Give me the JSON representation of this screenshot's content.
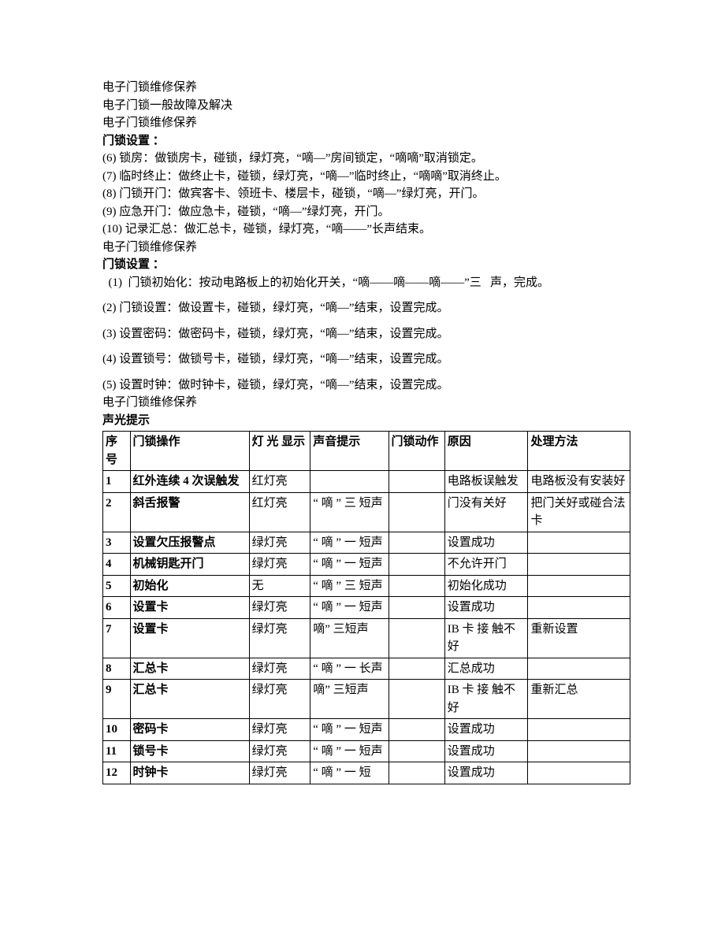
{
  "title1": "电子门锁维修保养",
  "title2": "电子门锁一般故障及解决",
  "title3": "电子门锁维修保养",
  "sec1_heading": "门锁设置 ：",
  "sec1_items": {
    "i6": "(6)  锁房：做锁房卡，碰锁，绿灯亮，“嘀—”房间锁定，“嘀嘀”取消锁定。",
    "i7": "(7)  临时终止：做终止卡，碰锁，绿灯亮，“嘀—”临时终止，“嘀嘀”取消终止。",
    "i8": "(8)  门锁开门：做宾客卡、领班卡、楼层卡，碰锁，“嘀—”绿灯亮，开门。",
    "i9": "(9)  应急开门：做应急卡，碰锁，“嘀—”绿灯亮，开门。",
    "i10": "(10) 记录汇总：做汇总卡，碰锁，绿灯亮，“嘀——”长声结束。"
  },
  "title4": "电子门锁维修保养",
  "sec2_heading": "门锁设置 ：",
  "sec2_items": {
    "i1": "  (1)  门锁初始化：按动电路板上的初始化开关，“嘀——嘀——嘀——”三   声，完成。",
    "i2": "(2)  门锁设置：做设置卡，碰锁，绿灯亮，“嘀—”结束，设置完成。",
    "i3": "(3)  设置密码：做密码卡，碰锁，绿灯亮，“嘀—”结束，设置完成。",
    "i4": "(4)  设置锁号：做锁号卡，碰锁，绿灯亮，“嘀—”结束，设置完成。",
    "i5": "(5)  设置时钟：做时钟卡，碰锁，绿灯亮，“嘀—”结束，设置完成。"
  },
  "title5": "电子门锁维修保养",
  "table_heading": "声光提示",
  "table": {
    "headers": {
      "seq": "序号",
      "op": "门锁操作",
      "led": "灯 光 显示",
      "snd": "声音提示",
      "act": "门锁动作",
      "rsn": "原因",
      "fix": "处理方法"
    },
    "rows": [
      {
        "seq": "1",
        "op": "红外连续 4 次误触发",
        "led": "红灯亮",
        "snd": "",
        "act": "",
        "rsn": "电路板误触发",
        "fix": "电路板没有安装好"
      },
      {
        "seq": "2",
        "op": "斜舌报警",
        "led": "红灯亮",
        "snd": "“ 嘀 ” 三 短声",
        "act": "",
        "rsn": "门没有关好",
        "fix": "把门关好或碰合法卡"
      },
      {
        "seq": "3",
        "op": "设置欠压报警点",
        "led": "绿灯亮",
        "snd": "“ 嘀 ” 一 短声",
        "act": "",
        "rsn": "设置成功",
        "fix": ""
      },
      {
        "seq": "4",
        "op": "机械钥匙开门",
        "led": "绿灯亮",
        "snd": "“ 嘀 ” 一 短声",
        "act": "",
        "rsn": "不允许开门",
        "fix": ""
      },
      {
        "seq": "5",
        "op": "初始化",
        "led": "无",
        "snd": "“ 嘀 ”  三 短声",
        "act": "",
        "rsn": "初始化成功",
        "fix": ""
      },
      {
        "seq": "6",
        "op": "设置卡",
        "led": "绿灯亮",
        "snd": "“ 嘀 ” 一 短声",
        "act": "",
        "rsn": "设置成功",
        "fix": ""
      },
      {
        "seq": "7",
        "op": "设置卡",
        "led": "绿灯亮",
        "snd": "嘀” 三短声",
        "act": "",
        "rsn": "IB 卡 接 触不好",
        "fix": "重新设置"
      },
      {
        "seq": "8",
        "op": "汇总卡",
        "led": "绿灯亮",
        "snd": "“ 嘀 ” 一 长声",
        "act": "",
        "rsn": "汇总成功",
        "fix": ""
      },
      {
        "seq": "9",
        "op": "汇总卡",
        "led": "绿灯亮",
        "snd": "嘀” 三短声",
        "act": "",
        "rsn": "IB 卡 接 触不好",
        "fix": "重新汇总"
      },
      {
        "seq": "10",
        "op": "密码卡",
        "led": "绿灯亮",
        "snd": "“ 嘀 ” 一 短声",
        "act": "",
        "rsn": "设置成功",
        "fix": ""
      },
      {
        "seq": "11",
        "op": "锁号卡",
        "led": "绿灯亮",
        "snd": "“ 嘀 ” 一 短声",
        "act": "",
        "rsn": "设置成功",
        "fix": ""
      },
      {
        "seq": "12",
        "op": "时钟卡",
        "led": "绿灯亮",
        "snd": "“ 嘀 ” 一 短",
        "act": "",
        "rsn": "设置成功",
        "fix": ""
      }
    ]
  }
}
